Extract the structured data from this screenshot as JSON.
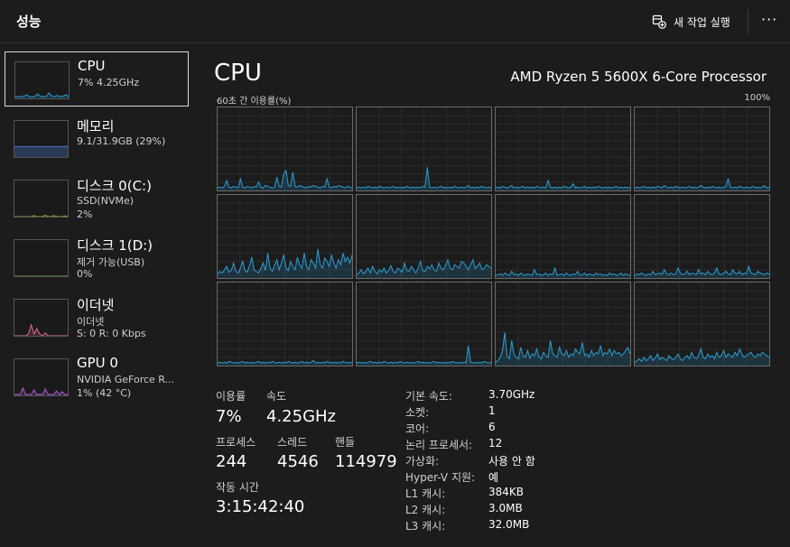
{
  "header": {
    "title": "성능",
    "run_task_label": "새 작업 실행",
    "more_label": "···"
  },
  "sidebar": [
    {
      "name": "CPU",
      "line1": "7% 4.25GHz",
      "line2": "",
      "color": "#2a9fd6",
      "values": [
        0.05,
        0.04,
        0.06,
        0.05,
        0.1,
        0.05,
        0.04,
        0.06,
        0.12,
        0.05,
        0.06,
        0.05,
        0.15,
        0.06,
        0.05,
        0.08,
        0.05,
        0.06,
        0.1,
        0.05
      ],
      "fill": false
    },
    {
      "name": "메모리",
      "line1": "9.1/31.9GB (29%)",
      "line2": "",
      "color": "#4a78c8",
      "values": [
        0.29,
        0.29,
        0.29,
        0.29,
        0.29,
        0.29,
        0.29,
        0.29,
        0.29,
        0.29,
        0.29,
        0.29,
        0.29,
        0.29,
        0.29,
        0.29,
        0.29,
        0.29,
        0.29,
        0.29
      ],
      "fill": true
    },
    {
      "name": "디스크 0(C:)",
      "line1": "SSD(NVMe)",
      "line2": "2%",
      "color": "#7fae2f",
      "values": [
        0,
        0,
        0,
        0,
        0,
        0,
        0,
        0.03,
        0,
        0,
        0,
        0.04,
        0,
        0,
        0.03,
        0,
        0,
        0,
        0.02,
        0
      ],
      "fill": false
    },
    {
      "name": "디스크 1(D:)",
      "line1": "제거 가능(USB)",
      "line2": "0%",
      "color": "#7fae2f",
      "values": [
        0,
        0,
        0,
        0,
        0,
        0,
        0,
        0,
        0,
        0,
        0,
        0,
        0,
        0,
        0,
        0,
        0,
        0,
        0,
        0
      ],
      "fill": false
    },
    {
      "name": "이더넷",
      "line1": "이더넷",
      "line2": "S: 0 R: 0 Kbps",
      "color": "#d9699a",
      "values": [
        0,
        0,
        0,
        0,
        0,
        0.05,
        0.3,
        0.05,
        0.2,
        0.05,
        0,
        0.08,
        0,
        0,
        0,
        0,
        0,
        0,
        0,
        0
      ],
      "fill": false
    },
    {
      "name": "GPU 0",
      "line1": "NVIDIA GeForce R...",
      "line2": "1% (42 °C)",
      "color": "#b05cd6",
      "values": [
        0.02,
        0.03,
        0.02,
        0.2,
        0.02,
        0.03,
        0.02,
        0.15,
        0.02,
        0.03,
        0.02,
        0.18,
        0.02,
        0.03,
        0.02,
        0.12,
        0.02,
        0.1,
        0.02,
        0.03
      ],
      "fill": false
    }
  ],
  "main": {
    "title": "CPU",
    "processor": "AMD Ryzen 5 5600X 6-Core Processor",
    "graph_label": "60초 간 이용률(%)",
    "graph_max": "100%",
    "line_color": "#2a9fd6"
  },
  "stats": {
    "usage_label": "이용률",
    "usage": "7%",
    "speed_label": "속도",
    "speed": "4.25GHz",
    "processes_label": "프로세스",
    "processes": "244",
    "threads_label": "스레드",
    "threads": "4546",
    "handles_label": "핸들",
    "handles": "114979",
    "uptime_label": "작동 시간",
    "uptime": "3:15:42:40"
  },
  "specs": [
    {
      "k": "기본 속도:",
      "v": "3.70GHz"
    },
    {
      "k": "소켓:",
      "v": "1"
    },
    {
      "k": "코어:",
      "v": "6"
    },
    {
      "k": "논리 프로세서:",
      "v": "12"
    },
    {
      "k": "가상화:",
      "v": "사용 안 함"
    },
    {
      "k": "Hyper-V 지원:",
      "v": "예"
    },
    {
      "k": "L1 캐시:",
      "v": "384KB"
    },
    {
      "k": "L2 캐시:",
      "v": "3.0MB"
    },
    {
      "k": "L3 캐시:",
      "v": "32.0MB"
    }
  ],
  "chart_data": {
    "type": "area",
    "title": "60초 간 이용률(%)",
    "ylim": [
      0,
      100
    ],
    "series": [
      {
        "values": [
          3,
          4,
          3,
          5,
          12,
          4,
          3,
          5,
          4,
          3,
          14,
          4,
          3,
          5,
          4,
          3,
          5,
          4,
          10,
          4,
          3,
          6,
          5,
          4,
          3,
          4,
          16,
          5,
          4,
          20,
          24,
          6,
          5,
          22,
          5,
          4,
          6,
          5,
          4,
          3,
          5,
          4,
          6,
          5,
          4,
          3,
          5,
          4,
          14,
          4,
          3,
          5,
          4,
          6,
          5,
          4,
          3,
          5,
          4,
          3
        ]
      },
      {
        "values": [
          3,
          4,
          3,
          4,
          3,
          5,
          4,
          3,
          4,
          3,
          5,
          4,
          3,
          4,
          3,
          4,
          5,
          3,
          4,
          3,
          4,
          3,
          5,
          4,
          3,
          4,
          3,
          4,
          3,
          5,
          4,
          28,
          4,
          3,
          4,
          3,
          4,
          5,
          3,
          4,
          3,
          4,
          3,
          5,
          4,
          3,
          4,
          3,
          4,
          6,
          3,
          4,
          3,
          4,
          3,
          5,
          4,
          3,
          4,
          3
        ]
      },
      {
        "values": [
          3,
          4,
          3,
          5,
          4,
          3,
          4,
          6,
          3,
          4,
          3,
          4,
          5,
          3,
          4,
          3,
          4,
          3,
          5,
          4,
          3,
          4,
          3,
          12,
          4,
          3,
          4,
          3,
          4,
          3,
          5,
          4,
          3,
          4,
          8,
          3,
          4,
          3,
          4,
          5,
          3,
          4,
          3,
          4,
          3,
          5,
          4,
          3,
          4,
          3,
          4,
          3,
          4,
          5,
          3,
          4,
          3,
          4,
          3,
          4
        ]
      },
      {
        "values": [
          3,
          4,
          3,
          4,
          5,
          3,
          4,
          3,
          4,
          3,
          5,
          4,
          3,
          6,
          4,
          3,
          4,
          3,
          5,
          4,
          3,
          4,
          3,
          4,
          5,
          3,
          4,
          3,
          4,
          6,
          4,
          3,
          4,
          3,
          5,
          4,
          3,
          4,
          3,
          4,
          5,
          14,
          4,
          3,
          4,
          3,
          5,
          4,
          3,
          4,
          3,
          4,
          5,
          3,
          4,
          3,
          4,
          6,
          3,
          4
        ]
      },
      {
        "values": [
          5,
          8,
          6,
          10,
          14,
          7,
          9,
          18,
          8,
          6,
          12,
          20,
          9,
          7,
          15,
          25,
          10,
          8,
          6,
          12,
          18,
          9,
          30,
          12,
          8,
          15,
          22,
          10,
          18,
          28,
          12,
          9,
          20,
          14,
          10,
          25,
          16,
          12,
          30,
          14,
          10,
          22,
          18,
          12,
          35,
          16,
          12,
          24,
          20,
          14,
          28,
          18,
          12,
          22,
          16,
          30,
          20,
          25,
          18,
          28
        ]
      },
      {
        "values": [
          4,
          6,
          10,
          5,
          8,
          12,
          6,
          14,
          8,
          5,
          10,
          7,
          12,
          6,
          9,
          15,
          8,
          6,
          12,
          10,
          7,
          18,
          9,
          8,
          14,
          10,
          6,
          12,
          20,
          9,
          8,
          14,
          11,
          16,
          10,
          8,
          18,
          12,
          10,
          15,
          22,
          12,
          10,
          16,
          14,
          12,
          20,
          18,
          14,
          10,
          16,
          22,
          12,
          14,
          18,
          10,
          12,
          16,
          14,
          12
        ]
      },
      {
        "values": [
          3,
          4,
          5,
          3,
          6,
          4,
          3,
          8,
          4,
          5,
          3,
          6,
          4,
          3,
          5,
          4,
          3,
          10,
          4,
          5,
          3,
          4,
          6,
          3,
          5,
          4,
          12,
          3,
          4,
          5,
          3,
          6,
          4,
          3,
          5,
          4,
          8,
          3,
          4,
          6,
          3,
          5,
          4,
          3,
          6,
          4,
          5,
          3,
          4,
          3,
          6,
          4,
          5,
          3,
          4,
          6,
          3,
          5,
          4,
          3
        ]
      },
      {
        "values": [
          3,
          5,
          4,
          6,
          4,
          3,
          5,
          4,
          8,
          4,
          5,
          6,
          4,
          10,
          5,
          4,
          6,
          4,
          5,
          12,
          6,
          4,
          5,
          8,
          4,
          6,
          5,
          4,
          10,
          5,
          6,
          4,
          8,
          5,
          4,
          6,
          12,
          5,
          4,
          6,
          8,
          5,
          4,
          10,
          6,
          5,
          8,
          4,
          6,
          5,
          14,
          6,
          5,
          4,
          8,
          6,
          5,
          4,
          6,
          5
        ]
      },
      {
        "values": [
          3,
          4,
          3,
          4,
          3,
          5,
          4,
          3,
          4,
          3,
          4,
          5,
          3,
          4,
          3,
          4,
          3,
          4,
          5,
          3,
          4,
          3,
          4,
          3,
          5,
          4,
          3,
          4,
          3,
          4,
          3,
          5,
          4,
          3,
          4,
          3,
          4,
          5,
          3,
          4,
          3,
          4,
          6,
          3,
          4,
          3,
          4,
          3,
          5,
          4,
          3,
          4,
          3,
          4,
          3,
          5,
          4,
          3,
          4,
          3
        ]
      },
      {
        "values": [
          3,
          4,
          3,
          4,
          3,
          4,
          5,
          3,
          4,
          3,
          4,
          3,
          5,
          4,
          3,
          4,
          3,
          4,
          3,
          5,
          4,
          3,
          4,
          3,
          4,
          3,
          4,
          5,
          3,
          4,
          3,
          4,
          3,
          4,
          5,
          3,
          4,
          3,
          4,
          3,
          4,
          3,
          5,
          4,
          3,
          4,
          3,
          4,
          3,
          24,
          4,
          3,
          4,
          3,
          4,
          3,
          5,
          4,
          3,
          4
        ]
      },
      {
        "values": [
          4,
          6,
          10,
          18,
          40,
          12,
          8,
          30,
          14,
          10,
          8,
          22,
          12,
          10,
          18,
          9,
          14,
          12,
          20,
          10,
          8,
          16,
          12,
          10,
          30,
          14,
          12,
          10,
          22,
          14,
          12,
          18,
          10,
          14,
          12,
          20,
          16,
          14,
          28,
          12,
          14,
          10,
          18,
          12,
          16,
          14,
          24,
          12,
          16,
          14,
          20,
          12,
          18,
          14,
          16,
          12,
          14,
          18,
          22,
          14
        ]
      },
      {
        "values": [
          4,
          6,
          8,
          5,
          10,
          6,
          8,
          12,
          6,
          9,
          14,
          7,
          10,
          8,
          6,
          12,
          9,
          7,
          10,
          14,
          8,
          6,
          10,
          12,
          8,
          16,
          10,
          8,
          12,
          20,
          10,
          8,
          14,
          10,
          12,
          8,
          16,
          10,
          12,
          18,
          10,
          14,
          12,
          10,
          16,
          12,
          20,
          14,
          10,
          12,
          14,
          16,
          12,
          10,
          14,
          12,
          16,
          14,
          12,
          10
        ]
      }
    ]
  }
}
